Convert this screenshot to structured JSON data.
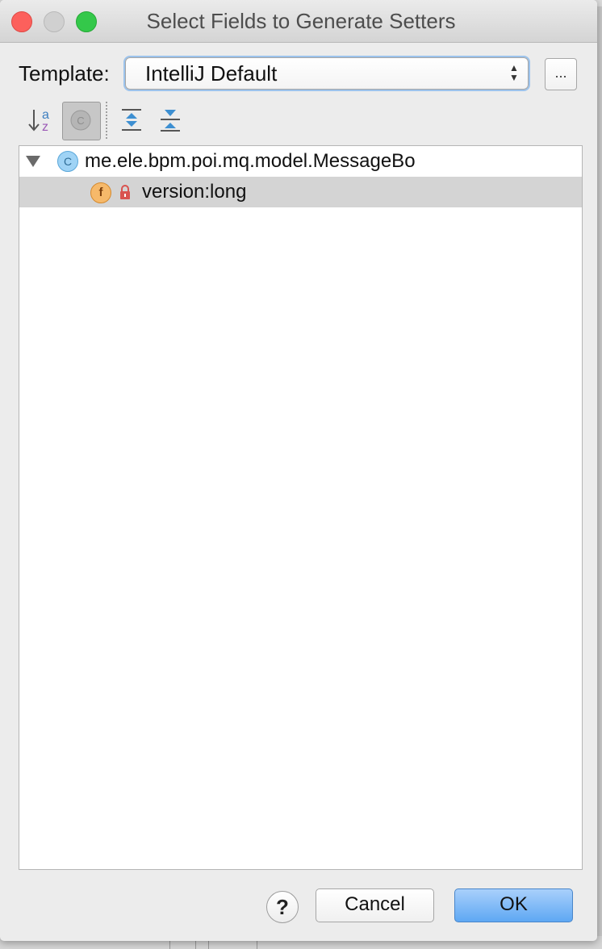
{
  "window": {
    "title": "Select Fields to Generate Setters"
  },
  "template": {
    "label": "Template:",
    "selected": "IntelliJ Default",
    "more_label": "..."
  },
  "toolbar": {
    "icons": [
      "sort-alphabetically-icon",
      "show-classes-icon",
      "expand-all-icon",
      "collapse-all-icon"
    ]
  },
  "tree": {
    "class_badge": "C",
    "class_name": "me.ele.bpm.poi.mq.model.MessageBo",
    "field_badge": "f",
    "field_label": "version:long"
  },
  "buttons": {
    "help_label": "?",
    "cancel_label": "Cancel",
    "ok_label": "OK"
  },
  "colors": {
    "ok_accent": "#5ea8f3",
    "selection": "#d4d4d4",
    "class_badge": "#9fd3f5",
    "field_badge": "#f6b96a",
    "lock": "#d9534f"
  }
}
